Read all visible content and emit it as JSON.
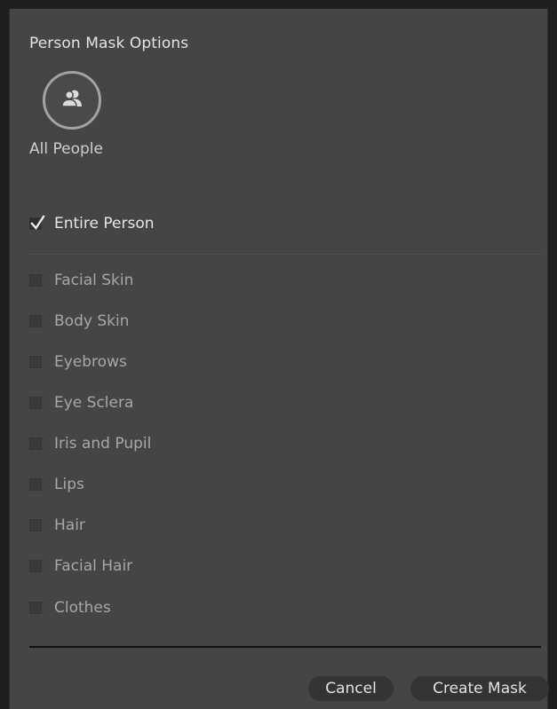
{
  "dialog": {
    "title": "Person Mask Options",
    "people_selector": {
      "icon": "people-icon",
      "label": "All People"
    },
    "entire_person": {
      "label": "Entire Person",
      "checked": true
    },
    "parts": [
      {
        "label": "Facial Skin",
        "checked": false
      },
      {
        "label": "Body Skin",
        "checked": false
      },
      {
        "label": "Eyebrows",
        "checked": false
      },
      {
        "label": "Eye Sclera",
        "checked": false
      },
      {
        "label": "Iris and Pupil",
        "checked": false
      },
      {
        "label": "Lips",
        "checked": false
      },
      {
        "label": "Hair",
        "checked": false
      },
      {
        "label": "Facial Hair",
        "checked": false
      },
      {
        "label": "Clothes",
        "checked": false
      }
    ],
    "buttons": {
      "cancel": "Cancel",
      "create": "Create Mask"
    }
  },
  "colors": {
    "panel_bg": "#454545",
    "text_primary": "#e4e4e4",
    "text_disabled": "#a7a7a7",
    "button_bg": "#343434"
  }
}
